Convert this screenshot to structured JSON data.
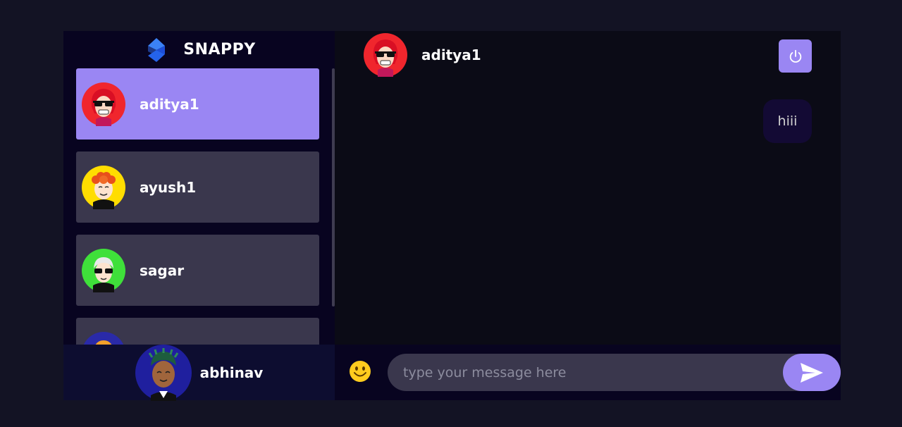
{
  "brand": {
    "name": "SNAPPY",
    "logo_icon": "snappy-logo-icon"
  },
  "contacts": [
    {
      "name": "aditya1",
      "avatar": "avatar-red-hair-sunglasses",
      "selected": true
    },
    {
      "name": "ayush1",
      "avatar": "avatar-orange-curly-hair",
      "selected": false
    },
    {
      "name": "sagar",
      "avatar": "avatar-white-hair-sunglasses",
      "selected": false
    },
    {
      "name": "",
      "avatar": "avatar-orange-hair-partial",
      "selected": false
    }
  ],
  "current_user": {
    "name": "abhinav",
    "avatar": "avatar-dreadlocks"
  },
  "chat": {
    "header_name": "aditya1",
    "header_avatar": "avatar-red-hair-sunglasses",
    "logout_icon": "power-icon",
    "messages": [
      {
        "text": "hiii",
        "sent": true
      }
    ]
  },
  "input": {
    "placeholder": "type your message here",
    "value": "",
    "emoji_icon": "smiley-icon",
    "send_icon": "send-icon"
  },
  "colors": {
    "accent": "#9a86f3",
    "page_bg": "#131324",
    "sidebar_bg": "#080420",
    "contact_bg": "#3a3a51"
  }
}
